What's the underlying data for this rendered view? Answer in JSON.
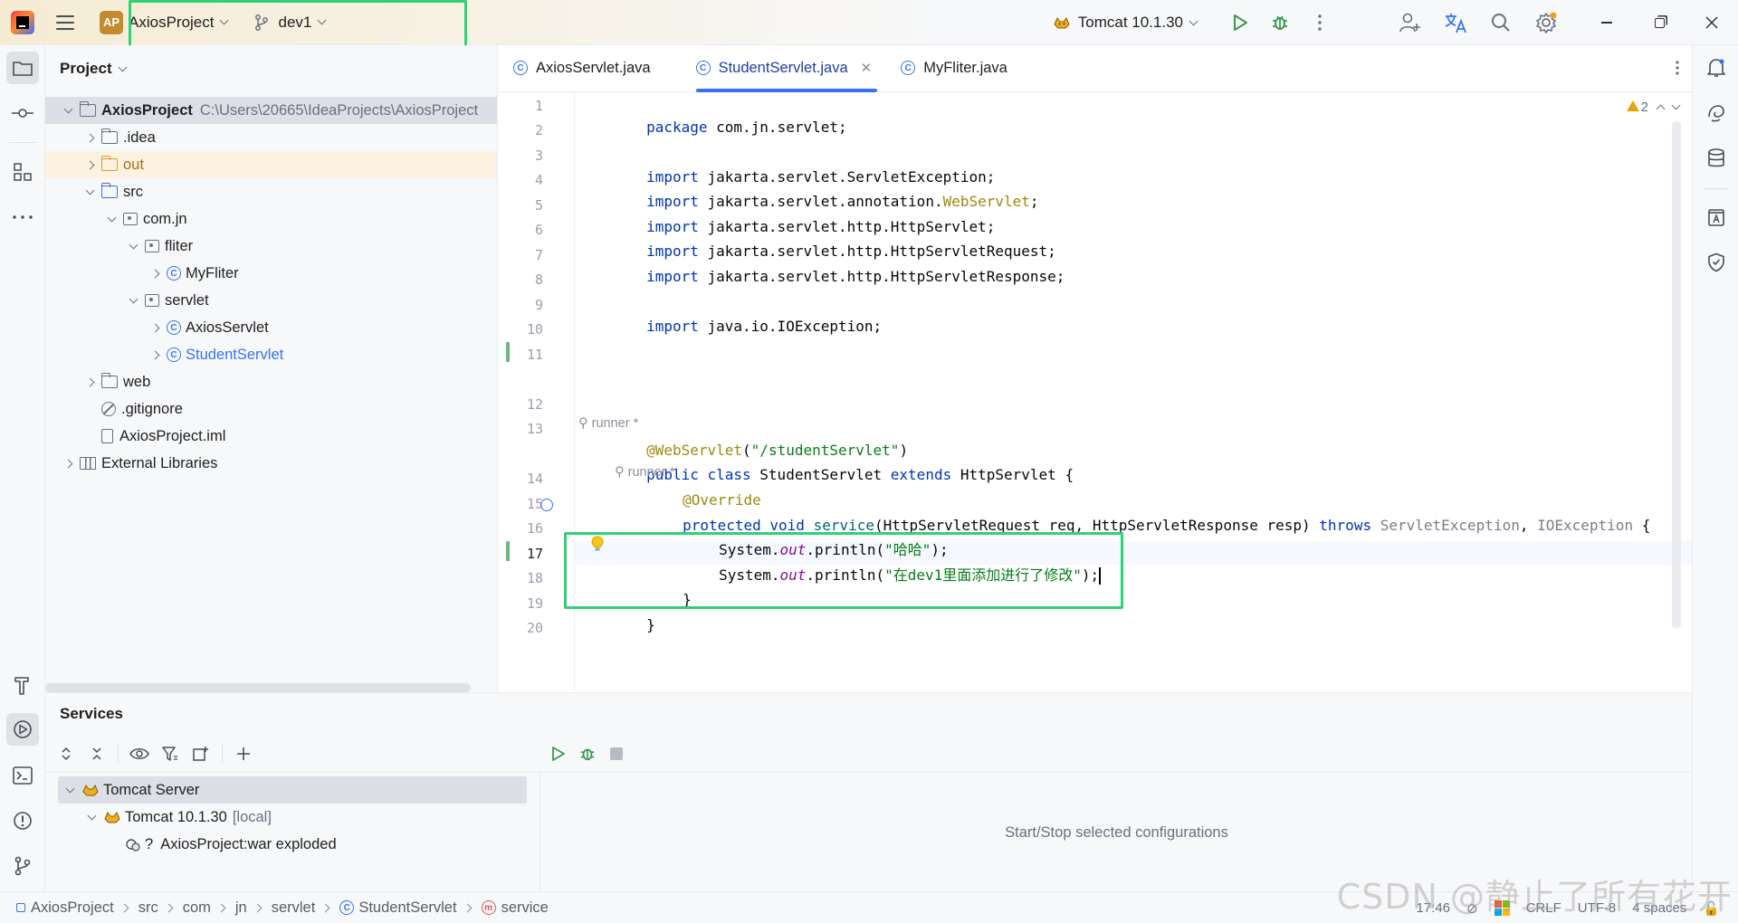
{
  "titlebar": {
    "project_badge": "AP",
    "project_name": "AxiosProject",
    "branch": "dev1",
    "run_config": "Tomcat 10.1.30",
    "icons": [
      "app-logo-icon",
      "hamburger-menu-icon",
      "branch-icon",
      "run-icon",
      "debug-icon",
      "more-icon",
      "add-user-icon",
      "translate-icon",
      "search-icon",
      "settings-icon",
      "minimize-icon",
      "maximize-icon",
      "close-icon"
    ]
  },
  "project_panel": {
    "title": "Project",
    "tree": [
      {
        "label": "AxiosProject",
        "path": "C:\\Users\\20665\\IdeaProjects\\AxiosProject",
        "icon": "module-folder-icon"
      },
      {
        "label": ".idea",
        "icon": "folder-icon"
      },
      {
        "label": "out",
        "icon": "excluded-folder-icon"
      },
      {
        "label": "src",
        "icon": "source-folder-icon"
      },
      {
        "label": "com.jn",
        "icon": "package-icon"
      },
      {
        "label": "fliter",
        "icon": "package-icon"
      },
      {
        "label": "MyFliter",
        "icon": "class-icon"
      },
      {
        "label": "servlet",
        "icon": "package-icon"
      },
      {
        "label": "AxiosServlet",
        "icon": "class-icon"
      },
      {
        "label": "StudentServlet",
        "icon": "class-icon"
      },
      {
        "label": "web",
        "icon": "web-folder-icon"
      },
      {
        "label": ".gitignore",
        "icon": "ignore-file-icon"
      },
      {
        "label": "AxiosProject.iml",
        "icon": "iml-file-icon"
      },
      {
        "label": "External Libraries",
        "icon": "library-icon"
      }
    ]
  },
  "editor": {
    "tabs": [
      {
        "label": "AxiosServlet.java"
      },
      {
        "label": "StudentServlet.java",
        "active": true
      },
      {
        "label": "MyFliter.java"
      }
    ],
    "warnings_count": "2",
    "line_numbers": [
      "1",
      "2",
      "3",
      "4",
      "5",
      "6",
      "7",
      "8",
      "9",
      "10",
      "11",
      "12",
      "13",
      "14",
      "15",
      "16",
      "17",
      "18",
      "19",
      "20"
    ],
    "author_hint": "runner *",
    "code": {
      "l1_kw": "package",
      "l1_rest": " com.jn.servlet;",
      "import_kw": "import",
      "l3": " jakarta.servlet.ServletException;",
      "l4_a": " jakarta.servlet.annotation.",
      "l4_b": "WebServlet",
      "l4_c": ";",
      "l5": " jakarta.servlet.http.HttpServlet;",
      "l6": " jakarta.servlet.http.HttpServletRequest;",
      "l7": " jakarta.servlet.http.HttpServletResponse;",
      "l9": " java.io.IOException;",
      "l12_ann": "@WebServlet",
      "l12_open": "(",
      "l12_str": "\"/studentServlet\"",
      "l12_close": ")",
      "l13_public": "public",
      "l13_class": " class",
      "l13_name": " StudentServlet ",
      "l13_extends": "extends",
      "l13_rest": " HttpServlet {",
      "l14_ann": "@Override",
      "l15_protected": "protected",
      "l15_void": " void",
      "l15_service": " service",
      "l15_params": "(HttpServletRequest req, HttpServletResponse resp) ",
      "l15_throws": "throws",
      "l15_ex1": " ServletException",
      "l15_comma": ", ",
      "l15_ex2": "IOException",
      "l15_brace": " {",
      "l16_a": "System.",
      "l16_out": "out",
      "l16_b": ".println(",
      "l16_str": "\"哈哈\"",
      "l16_c": ");",
      "l17_a": "System.",
      "l17_out": "out",
      "l17_b": ".println(",
      "l17_str": "\"在dev1里面添加进行了修改\"",
      "l17_c": ");",
      "l18": "}",
      "l19": "}"
    }
  },
  "services": {
    "title": "Services",
    "tree": [
      {
        "label": "Tomcat Server"
      },
      {
        "label": "Tomcat 10.1.30",
        "suffix": "[local]"
      },
      {
        "label": "AxiosProject:war exploded",
        "prefix": "?"
      }
    ],
    "empty_text": "Start/Stop selected configurations"
  },
  "statusbar": {
    "breadcrumbs": [
      "AxiosProject",
      "src",
      "com",
      "jn",
      "servlet",
      "StudentServlet",
      "service"
    ],
    "time": "17:46",
    "line_ending": "CRLF",
    "encoding": "UTF-8",
    "indent": "4 spaces"
  },
  "watermark": "CSDN @静止了所有花开",
  "colors": {
    "accent": "#3574f0",
    "highlight_box": "#2fd177",
    "keyword": "#0033b3",
    "annotation": "#9e880d",
    "string": "#067d17"
  }
}
